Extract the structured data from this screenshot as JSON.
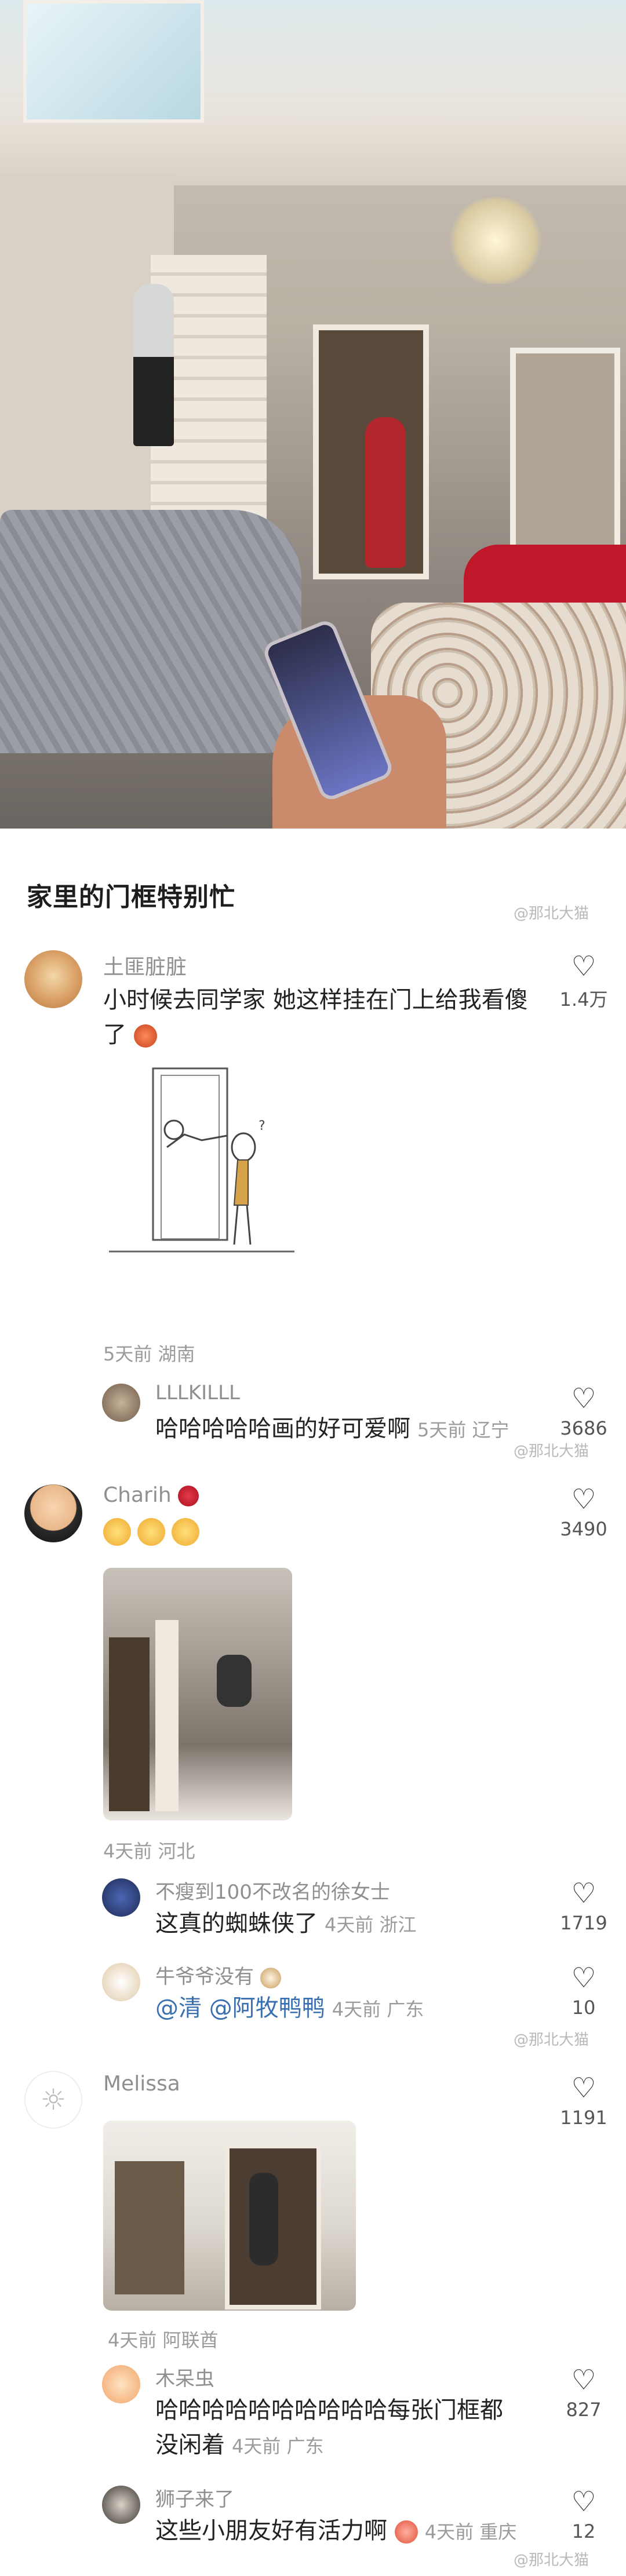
{
  "post": {
    "title": "家里的门框特别忙"
  },
  "watermark": "@那北大猫",
  "comments": [
    {
      "user": "土匪脏脏",
      "text": "小时候去同学家 她这样挂在门上给我看傻了",
      "likes": "1.4万",
      "meta": "5天前 湖南",
      "reply": {
        "user": "LLLKILLL",
        "text": "哈哈哈哈哈画的好可爱啊",
        "meta": "5天前 辽宁",
        "likes": "3686"
      }
    },
    {
      "user": "Charih",
      "likes": "3490",
      "meta": "4天前 河北",
      "replies": [
        {
          "user": "不瘦到100不改名的徐女士",
          "text": "这真的蜘蛛侠了",
          "meta": "4天前 浙江",
          "likes": "1719"
        },
        {
          "user": "牛爷爷没有",
          "mention1": "@清",
          "mention2": "@阿牧鸭鸭",
          "meta": "4天前 广东",
          "likes": "10"
        }
      ]
    },
    {
      "user": "Melissa",
      "likes": "1191",
      "meta": "4天前 阿联酋",
      "replies": [
        {
          "user": "木呆虫",
          "text_line1": "哈哈哈哈哈哈哈哈哈哈每张门框都",
          "text_line2": "没闲着",
          "meta": "4天前 广东",
          "likes": "827"
        },
        {
          "user": "狮子来了",
          "text": "这些小朋友好有活力啊",
          "meta": "4天前 重庆",
          "likes": "12"
        }
      ]
    }
  ],
  "icons": {
    "like": "heart-outline-icon"
  },
  "colors": {
    "mention": "#3a6fb0",
    "meta": "#9b9b9b"
  }
}
